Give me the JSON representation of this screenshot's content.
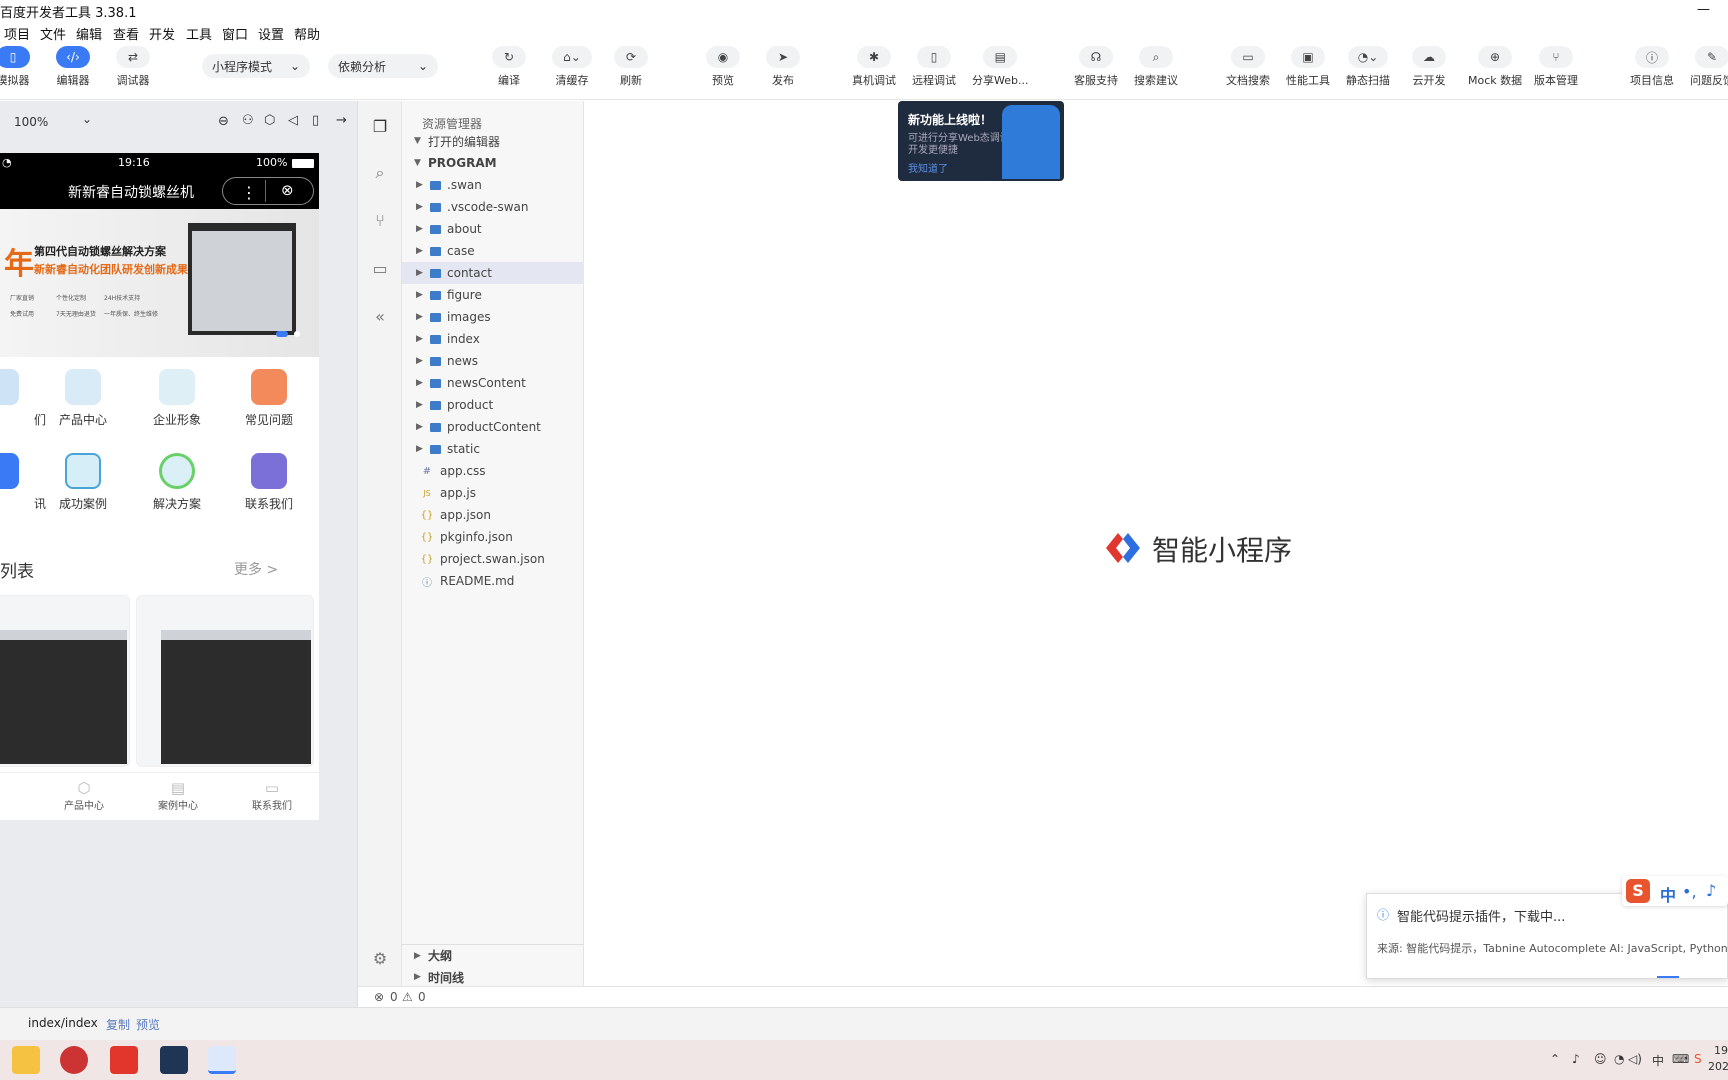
{
  "window": {
    "title": "百度开发者工具 3.38.1"
  },
  "menu": [
    "项目",
    "文件",
    "编辑",
    "查看",
    "开发",
    "工具",
    "窗口",
    "设置",
    "帮助"
  ],
  "toolbar": {
    "left": [
      {
        "label": "模拟器",
        "icon": "phone-icon",
        "active": true
      },
      {
        "label": "编辑器",
        "icon": "code-icon",
        "active": true
      },
      {
        "label": "调试器",
        "icon": "swap-icon",
        "active": false
      }
    ],
    "mode_select": "小程序模式",
    "dep_select": "依赖分析",
    "actions": [
      {
        "label": "编译",
        "icon": "refresh-icon"
      },
      {
        "label": "清缓存",
        "icon": "broom-icon"
      },
      {
        "label": "刷新",
        "icon": "reload-icon"
      },
      {
        "label": "预览",
        "icon": "eye-icon"
      },
      {
        "label": "发布",
        "icon": "send-icon"
      },
      {
        "label": "真机调试",
        "icon": "bug-icon"
      },
      {
        "label": "远程调试",
        "icon": "mobile-icon"
      },
      {
        "label": "分享Web...",
        "icon": "share-icon"
      },
      {
        "label": "客服支持",
        "icon": "headset-icon"
      },
      {
        "label": "搜索建议",
        "icon": "search-icon"
      },
      {
        "label": "文档搜索",
        "icon": "doc-icon"
      },
      {
        "label": "性能工具",
        "icon": "monitor-icon"
      },
      {
        "label": "静态扫描",
        "icon": "scan-icon"
      },
      {
        "label": "云开发",
        "icon": "cloud-icon"
      },
      {
        "label": "Mock 数据",
        "icon": "globe-icon"
      },
      {
        "label": "版本管理",
        "icon": "branch-icon"
      },
      {
        "label": "项目信息",
        "icon": "info-icon"
      },
      {
        "label": "问题反馈",
        "icon": "pen-icon"
      }
    ]
  },
  "sim": {
    "zoom": "100%",
    "status_time": "19:16",
    "battery": "100%",
    "nav_title": "新新睿自动锁螺丝机",
    "banner_line1": "第四代自动锁螺丝解决方案",
    "banner_line2": "新新睿自动化团队研发创新成果",
    "banner_big": "年",
    "banner_points": [
      "厂家直销",
      "个性化定制",
      "24H技术支持",
      "免费试用",
      "7天无理由退货",
      "一年质保、终生维修"
    ],
    "grid": [
      {
        "label": "们"
      },
      {
        "label": "产品中心"
      },
      {
        "label": "企业形象"
      },
      {
        "label": "常见问题"
      },
      {
        "label": "讯"
      },
      {
        "label": "成功案例"
      },
      {
        "label": "解决方案"
      },
      {
        "label": "联系我们"
      }
    ],
    "section_title": "列表",
    "more": "更多 >",
    "tabbar": [
      "产品中心",
      "案例中心",
      "联系我们"
    ],
    "footer_path": "index/index",
    "footer_copy": "复制",
    "footer_preview": "预览"
  },
  "explorer": {
    "title": "资源管理器",
    "open_editors": "打开的编辑器",
    "root": "PROGRAM",
    "folders": [
      ".swan",
      ".vscode-swan",
      "about",
      "case",
      "contact",
      "figure",
      "images",
      "index",
      "news",
      "newsContent",
      "product",
      "productContent",
      "static"
    ],
    "selected": "contact",
    "files": [
      {
        "name": "app.css",
        "icon": "#"
      },
      {
        "name": "app.js",
        "icon": "JS"
      },
      {
        "name": "app.json",
        "icon": "{}"
      },
      {
        "name": "pkginfo.json",
        "icon": "{}"
      },
      {
        "name": "project.swan.json",
        "icon": "{}"
      },
      {
        "name": "README.md",
        "icon": "ⓘ"
      }
    ],
    "outline": "大纲",
    "timeline": "时间线"
  },
  "editor": {
    "brand": "智能小程序"
  },
  "tooltip": {
    "title": "新功能上线啦！",
    "body1": "可进行分享Web态调试",
    "body2": "开发更便捷",
    "link": "我知道了"
  },
  "statusbar": {
    "errors": "0",
    "warnings": "0"
  },
  "notification": {
    "title": "智能代码提示插件，下载中...",
    "source": "来源: 智能代码提示，Tabnine Autocomplete AI: JavaScript, Python,"
  },
  "ime": {
    "label": "中"
  },
  "clock": {
    "time": "19",
    "date": "202"
  }
}
